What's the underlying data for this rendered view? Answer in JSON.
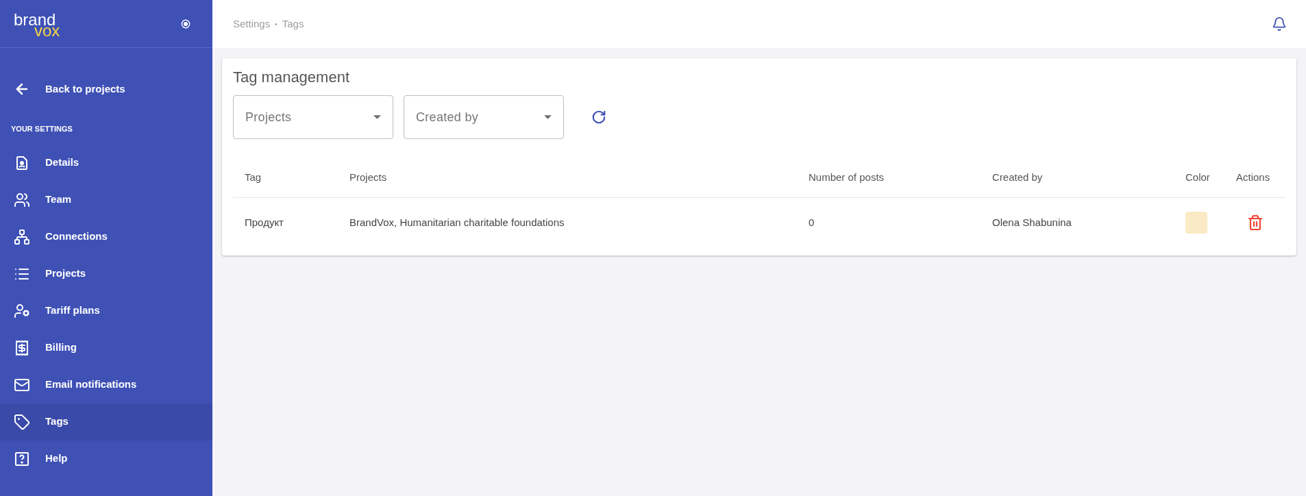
{
  "sidebar": {
    "logo": {
      "first": "brand",
      "second": "vox"
    },
    "back_link": "Back to projects",
    "section_title": "YOUR SETTINGS",
    "items": [
      {
        "label": "Details",
        "selected": false
      },
      {
        "label": "Team",
        "selected": false
      },
      {
        "label": "Connections",
        "selected": false
      },
      {
        "label": "Projects",
        "selected": false
      },
      {
        "label": "Tariff plans",
        "selected": false
      },
      {
        "label": "Billing",
        "selected": false
      },
      {
        "label": "Email notifications",
        "selected": false
      },
      {
        "label": "Tags",
        "selected": true
      },
      {
        "label": "Help",
        "selected": false
      }
    ]
  },
  "breadcrumb": [
    "Settings",
    "•",
    "Tags"
  ],
  "card": {
    "title": "Tag management",
    "filters": [
      {
        "placeholder": "Projects"
      },
      {
        "placeholder": "Created by"
      }
    ],
    "table": {
      "columns": [
        "Tag",
        "Projects",
        "Number of posts",
        "Created by",
        "Color",
        "Actions"
      ],
      "rows": [
        {
          "tag": "Продукт",
          "projects": "BrandVox, Humanitarian charitable foundations",
          "posts": "0",
          "created_by": "Olena Shabunina",
          "color": "#fbeac6"
        }
      ]
    }
  }
}
